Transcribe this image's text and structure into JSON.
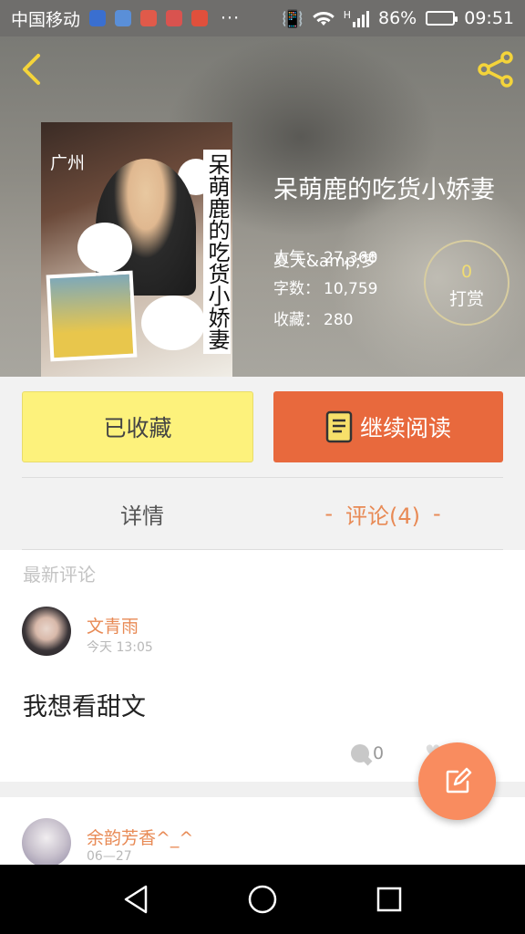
{
  "status_bar": {
    "carrier": "中国移动",
    "more": "···",
    "signal_label": "H",
    "battery_percent": "86%",
    "battery_level": 0.86,
    "time": "09:51"
  },
  "book": {
    "cover_city": "广州",
    "cover_title": "呆萌鹿的吃货小娇妻",
    "title": "呆萌鹿的吃货小娇妻",
    "author": "夏天&amp;梦",
    "stats": [
      {
        "label": "人气：",
        "value": "27,360"
      },
      {
        "label": "字数：",
        "value": "10,759"
      },
      {
        "label": "收藏：",
        "value": "280"
      }
    ],
    "tip_count": "0",
    "tip_label": "打赏"
  },
  "actions": {
    "favorite_label": "已收藏",
    "read_label": "继续阅读"
  },
  "tabs": {
    "detail_label": "详情",
    "comments_label": "评论(4)",
    "dash": "-"
  },
  "comments": {
    "section_title": "最新评论",
    "items": [
      {
        "user": "文青雨",
        "time": "今天 13:05",
        "text": "我想看甜文",
        "reply_count": "0"
      },
      {
        "user": "余韵芳香^_^",
        "time": "06—27"
      }
    ]
  },
  "colors": {
    "accent_orange": "#e8693d",
    "fav_yellow": "#fdf27c",
    "fab_orange": "#f98c5f",
    "username_orange": "#e88a55"
  }
}
